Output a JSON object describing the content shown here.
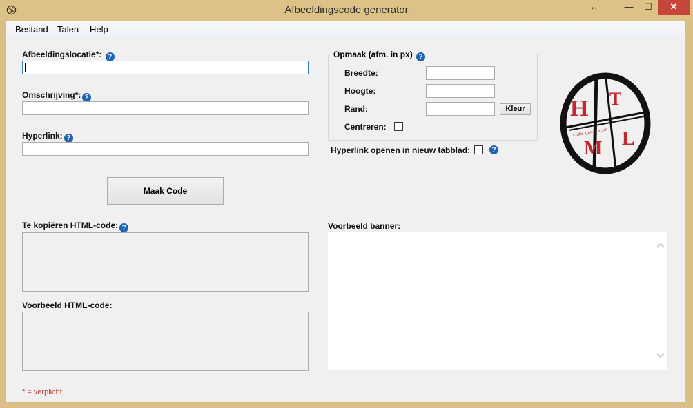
{
  "window": {
    "title": "Afbeeldingscode generator",
    "move_glyph": "↔",
    "min_glyph": "—",
    "max_glyph": "☐",
    "close_glyph": "✕"
  },
  "menu": {
    "items": [
      "Bestand",
      "Talen",
      "Help"
    ]
  },
  "form": {
    "image_location_label": "Afbeeldingslocatie*:",
    "image_location_value": "",
    "description_label": "Omschrijving*:",
    "description_value": "",
    "hyperlink_label": "Hyperlink:",
    "hyperlink_value": "",
    "make_code_button": "Maak Code",
    "copy_html_label": "Te kopiëren HTML-code:",
    "preview_html_label": "Voorbeeld HTML-code:",
    "required_note": "* = verplicht"
  },
  "layout_group": {
    "title": "Opmaak (afm. in px)",
    "width_label": "Breedte:",
    "width_value": "",
    "height_label": "Hoogte:",
    "height_value": "",
    "border_label": "Rand:",
    "border_value": "",
    "color_button": "Kleur",
    "center_label": "Centreren:",
    "center_checked": false
  },
  "new_tab_label": "Hyperlink openen in nieuw tabblad:",
  "new_tab_checked": false,
  "preview_banner_label": "Voorbeeld banner:",
  "help_glyph": "?",
  "logo": {
    "letters": [
      "H",
      "T",
      "M",
      "L"
    ],
    "ring_text": "code generator",
    "colors": {
      "ring": "#111111",
      "letters": "#c0282e"
    }
  },
  "icons": [
    "app-icon",
    "help-icon",
    "scroll-up-icon",
    "scroll-down-icon",
    "checkbox"
  ]
}
